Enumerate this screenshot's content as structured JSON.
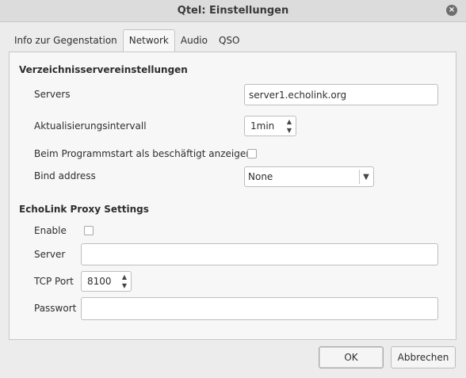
{
  "window": {
    "title": "Qtel: Einstellungen",
    "close_icon": "×"
  },
  "tabs": [
    {
      "label": "Info zur Gegenstation",
      "active": false
    },
    {
      "label": "Network",
      "active": true
    },
    {
      "label": "Audio",
      "active": false
    },
    {
      "label": "QSO",
      "active": false
    }
  ],
  "directory": {
    "title": "Verzeichnisservereinstellungen",
    "servers_label": "Servers",
    "servers_value": "server1.echolink.org",
    "update_label": "Aktualisierungsintervall",
    "update_value": "1min",
    "busy_label": "Beim Programmstart als beschäftigt anzeigen",
    "busy_checked": false,
    "bind_label": "Bind address",
    "bind_value": "None"
  },
  "proxy": {
    "title": "EchoLink Proxy Settings",
    "enable_label": "Enable",
    "enable_checked": false,
    "server_label": "Server",
    "server_value": "",
    "port_label": "TCP Port",
    "port_value": "8100",
    "password_label": "Passwort",
    "password_value": ""
  },
  "buttons": {
    "ok": "OK",
    "cancel": "Abbrechen"
  }
}
